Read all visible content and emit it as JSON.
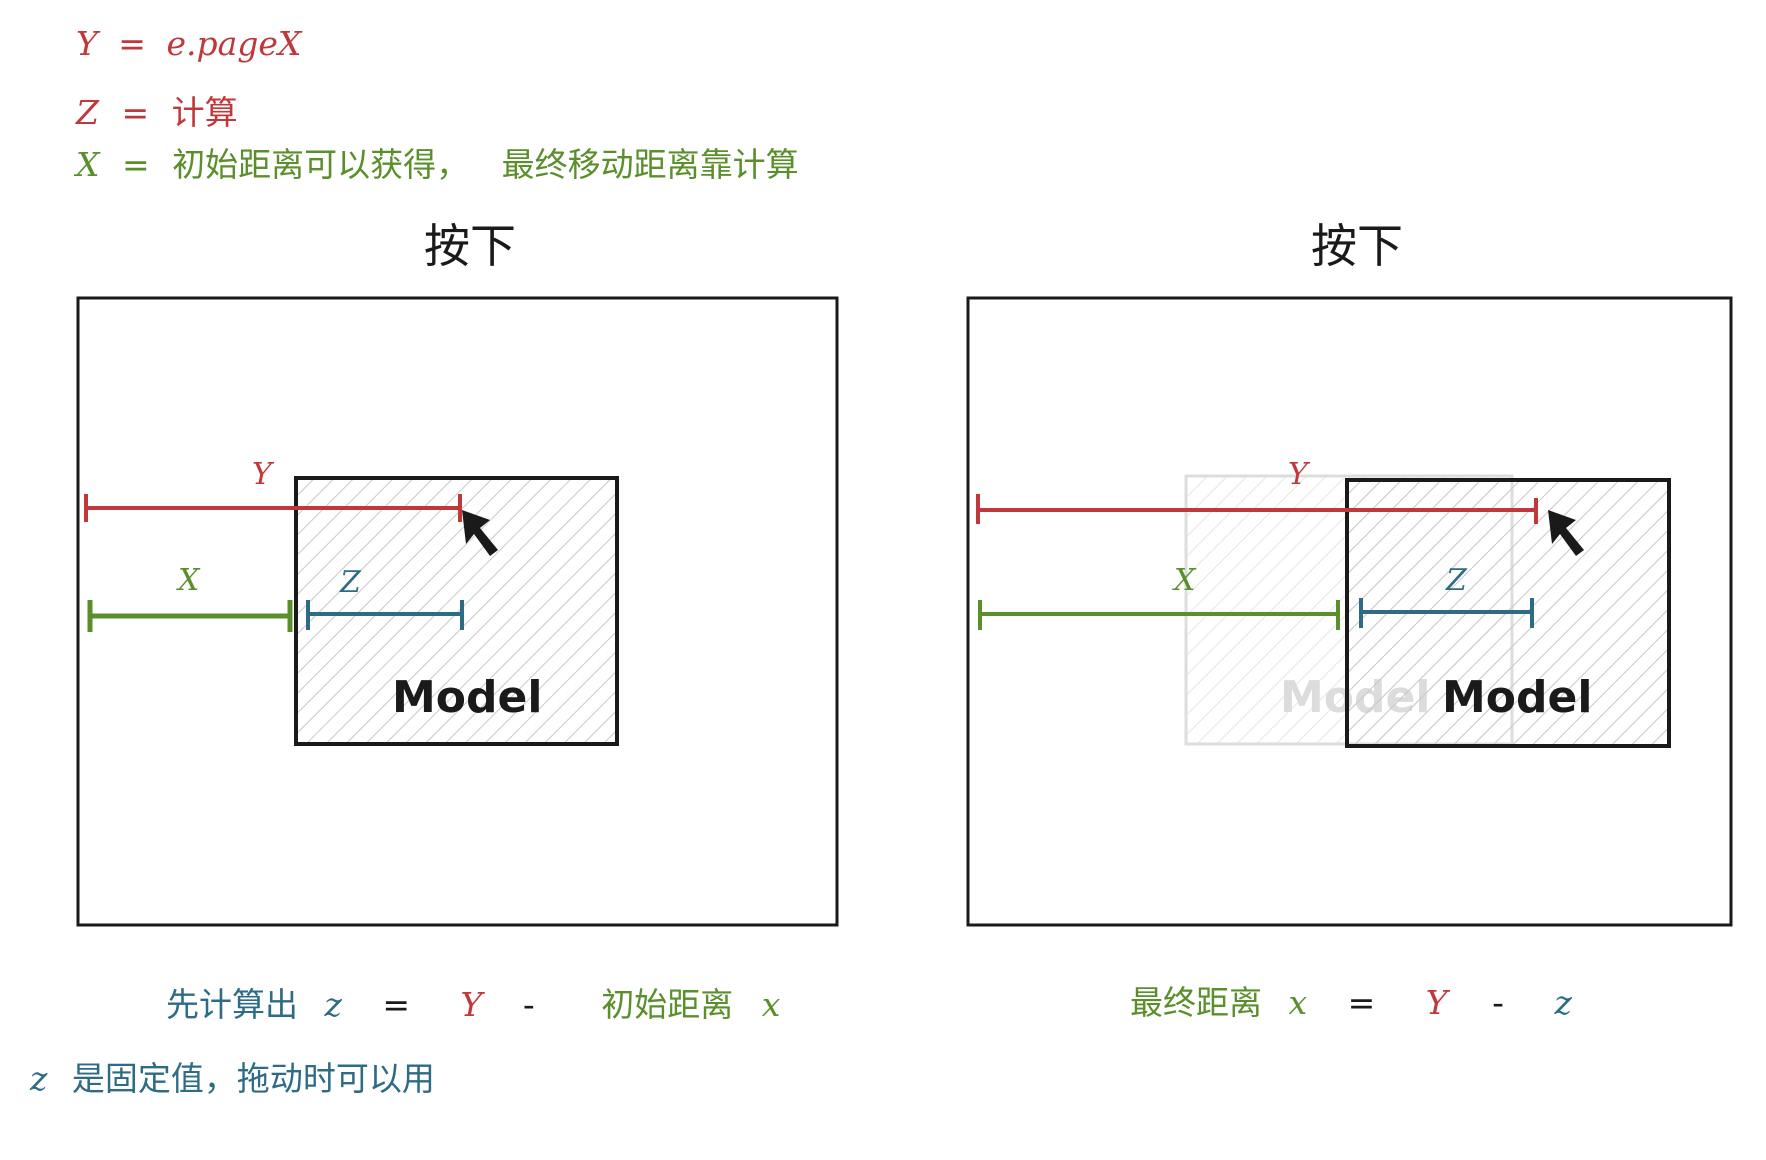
{
  "notes": {
    "y_def": {
      "var": "Y",
      "eq": "=",
      "expr": "e.pageX"
    },
    "z_def": {
      "var": "Z",
      "eq": "=",
      "expr": "计算"
    },
    "x_def": {
      "var": "X",
      "eq": "=",
      "expr1": "初始距离可以获得，",
      "expr2": "最终移动距离靠计算"
    }
  },
  "panels": [
    {
      "title": "按下",
      "labels": {
        "y": "Y",
        "x": "X",
        "z": "Z"
      },
      "model_label": "Model",
      "caption": {
        "prefix": "先计算出",
        "z": "z",
        "eq": "=",
        "y": "Y",
        "minus": "-",
        "dist": "初始距离",
        "x": "x"
      }
    },
    {
      "title": "按下",
      "labels": {
        "y": "Y",
        "x": "X",
        "z": "Z"
      },
      "model_label": "Model",
      "ghost_model_label": "Model",
      "caption": {
        "prefix": "最终距离",
        "x": "x",
        "eq": "=",
        "y": "Y",
        "minus": "-",
        "z": "z"
      }
    }
  ],
  "footer": {
    "z": "z",
    "text": "是固定值，拖动时可以用"
  },
  "colors": {
    "red": "#c0383a",
    "green": "#5a8f2b",
    "blue": "#2e6b85",
    "ink": "#1a1a1a"
  }
}
